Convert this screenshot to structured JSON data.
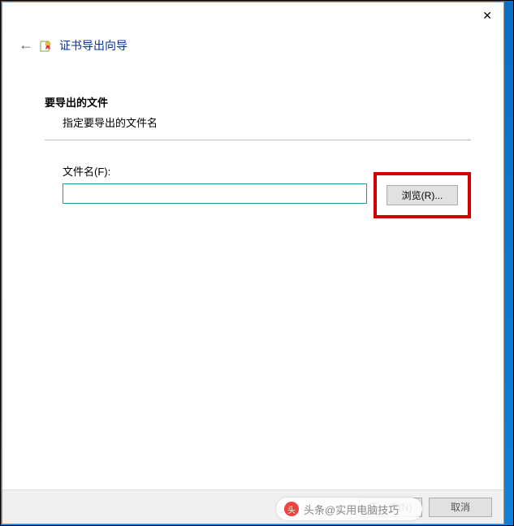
{
  "wizard": {
    "title": "证书导出向导",
    "back_arrow": "←"
  },
  "section": {
    "title": "要导出的文件",
    "desc": "指定要导出的文件名"
  },
  "field": {
    "label": "文件名(F):",
    "value": ""
  },
  "buttons": {
    "browse": "浏览(R)...",
    "next": "下一步(N)",
    "cancel": "取消"
  },
  "close_symbol": "✕",
  "watermark": {
    "logo_text": "头",
    "text": "头条@实用电脑技巧"
  }
}
